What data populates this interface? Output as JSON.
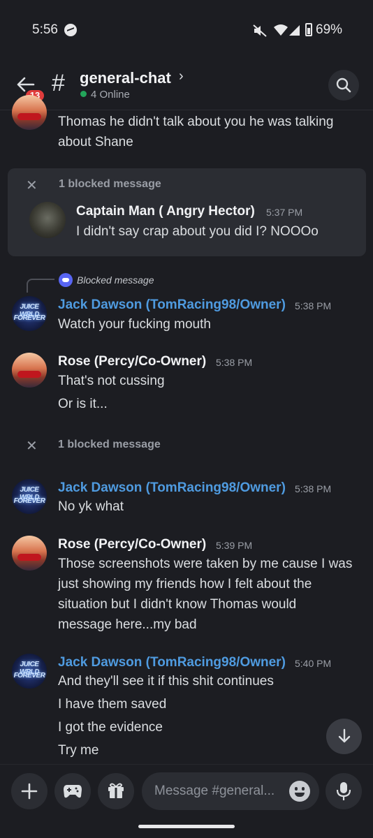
{
  "status_bar": {
    "time": "5:56",
    "battery": "69%"
  },
  "header": {
    "channel_name": "general-chat",
    "online": "4 Online",
    "back_badge": "13"
  },
  "messages": {
    "partial": {
      "lines": [
        "Thomas he didn't talk about you he was talking",
        "about Shane"
      ]
    },
    "blocked1": {
      "label": "1 blocked message",
      "author": "Captain Man ( Angry Hector)",
      "time": "5:37 PM",
      "text": "I didn't say crap about you did I? NOOOo"
    },
    "reply": {
      "label": "Blocked message"
    },
    "m1": {
      "author": "Jack Dawson (TomRacing98/Owner)",
      "time": "5:38 PM",
      "lines": [
        "Watch your fucking mouth"
      ]
    },
    "m2": {
      "author": "Rose (Percy/Co-Owner)",
      "time": "5:38 PM",
      "lines": [
        "That's not cussing",
        "Or is it..."
      ]
    },
    "blocked2": {
      "label": "1 blocked message"
    },
    "m3": {
      "author": "Jack Dawson (TomRacing98/Owner)",
      "time": "5:38 PM",
      "lines": [
        "No yk what"
      ]
    },
    "m4": {
      "author": "Rose (Percy/Co-Owner)",
      "time": "5:39 PM",
      "lines": [
        "Those screenshots were taken by me cause I was",
        "just showing my friends how I felt about the",
        "situation but I didn't know Thomas would",
        "message here...my bad"
      ]
    },
    "m5": {
      "author": "Jack Dawson (TomRacing98/Owner)",
      "time": "5:40 PM",
      "lines": [
        "And they'll see it if this shit continues",
        "I have them saved",
        "I got the evidence",
        "Try me"
      ]
    }
  },
  "avatar_text": {
    "juice_top": "JUICE WRLD",
    "juice_bottom": "FOREVER"
  },
  "composer": {
    "placeholder": "Message #general..."
  },
  "colors": {
    "background": "#1c1d22",
    "accent_blue": "#4f9be0",
    "online_green": "#23a55a",
    "badge_red": "#e03c3c",
    "discord_blurple": "#5865f2"
  }
}
